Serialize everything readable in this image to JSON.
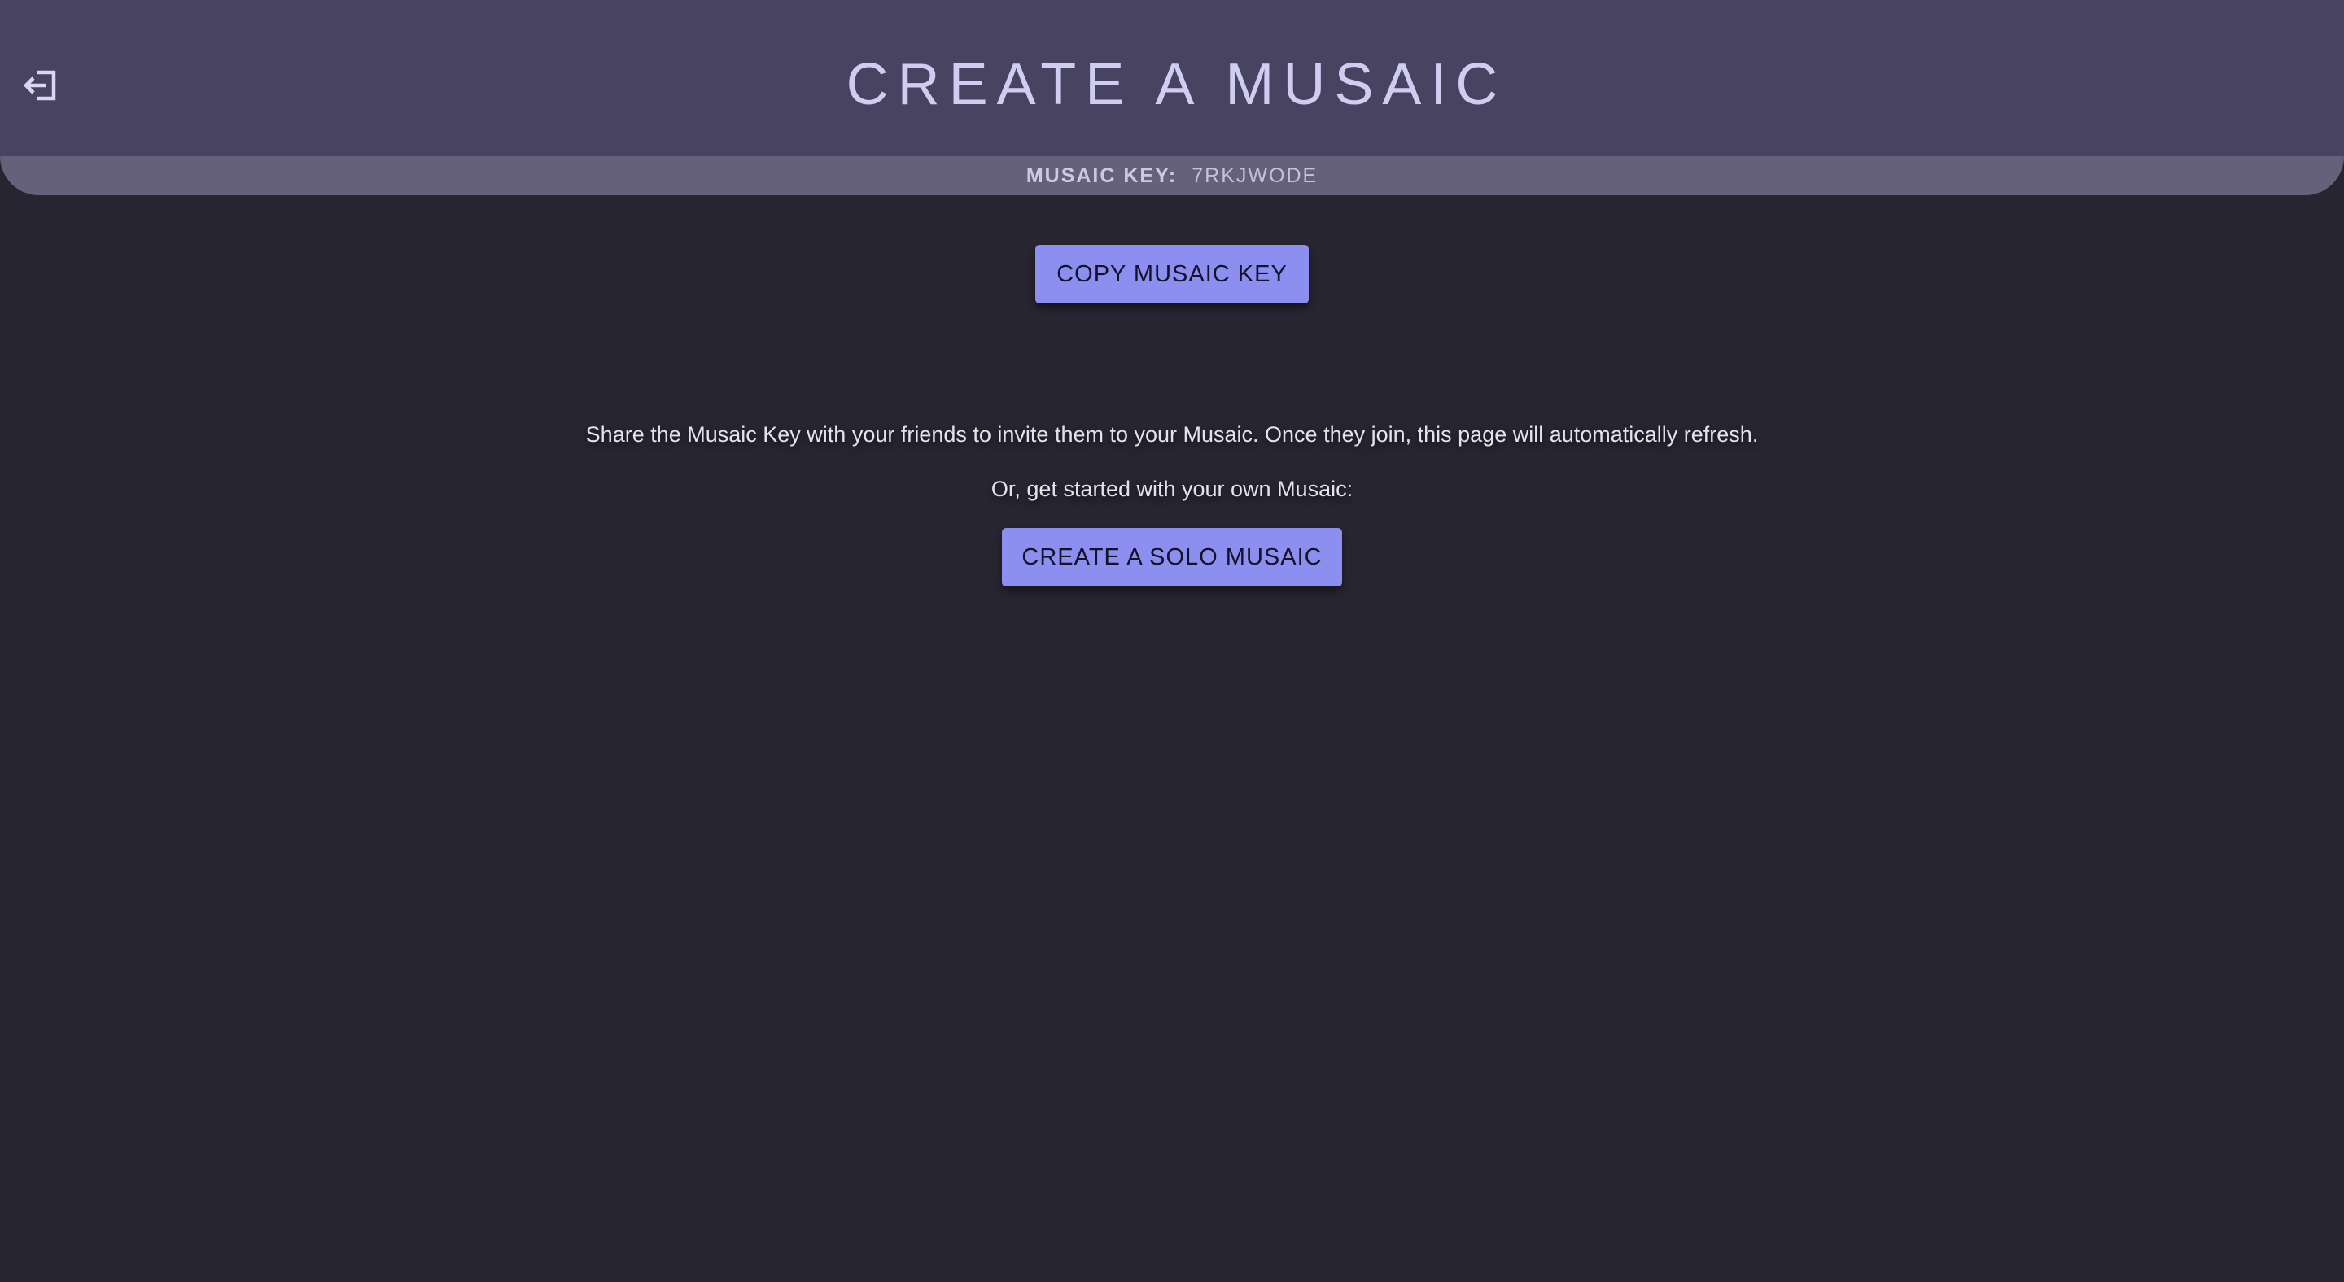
{
  "header": {
    "title": "CREATE A MUSAIC",
    "exit_icon": "exit-icon"
  },
  "key_bar": {
    "label": "MUSAIC KEY:",
    "value": "7RKJWODE"
  },
  "actions": {
    "copy_label": "COPY MUSAIC KEY",
    "solo_label": "CREATE A SOLO MUSAIC"
  },
  "messages": {
    "share": "Share the Musaic Key with your friends to invite them to your Musaic. Once they join, this page will automatically refresh.",
    "solo_prompt": "Or, get started with your own Musaic:"
  },
  "colors": {
    "background": "#272531",
    "header": "#484360",
    "key_bar": "#65617b",
    "accent": "#8c8ef0",
    "title": "#cfcdf1"
  }
}
